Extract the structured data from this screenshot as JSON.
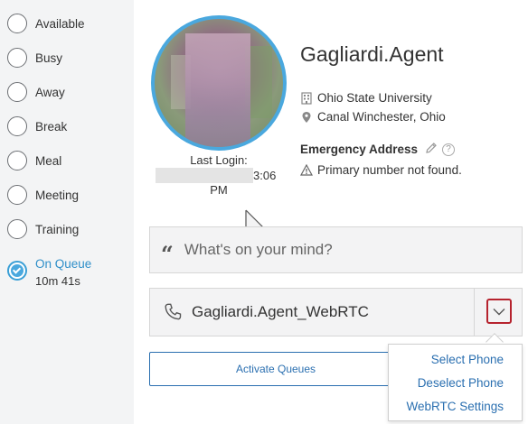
{
  "statuses": [
    {
      "label": "Available"
    },
    {
      "label": "Busy"
    },
    {
      "label": "Away"
    },
    {
      "label": "Break"
    },
    {
      "label": "Meal"
    },
    {
      "label": "Meeting"
    },
    {
      "label": "Training"
    },
    {
      "label": "On Queue",
      "active": true,
      "timer": "10m 41s"
    }
  ],
  "profile": {
    "last_login_label": "Last Login:",
    "last_login_time": "3:06",
    "last_login_ampm": "PM",
    "agent_name": "Gagliardi.Agent",
    "organization": "Ohio State University",
    "location": "Canal Winchester, Ohio",
    "emergency_label": "Emergency Address",
    "emergency_warning": "Primary number not found."
  },
  "speech": {
    "placeholder": "What's on your mind?"
  },
  "phone": {
    "name": "Gagliardi.Agent_WebRTC"
  },
  "activate_button": "Activate Queues",
  "phone_menu": {
    "items": [
      "Select Phone",
      "Deselect Phone",
      "WebRTC Settings"
    ]
  },
  "colors": {
    "accent": "#4aa8de",
    "link": "#2a6fb0",
    "highlight_border": "#b6232e"
  },
  "icons": [
    "building-icon",
    "location-pin-icon",
    "pencil-icon",
    "help-icon",
    "warning-icon",
    "quote-icon",
    "phone-icon",
    "chevron-down-icon"
  ]
}
